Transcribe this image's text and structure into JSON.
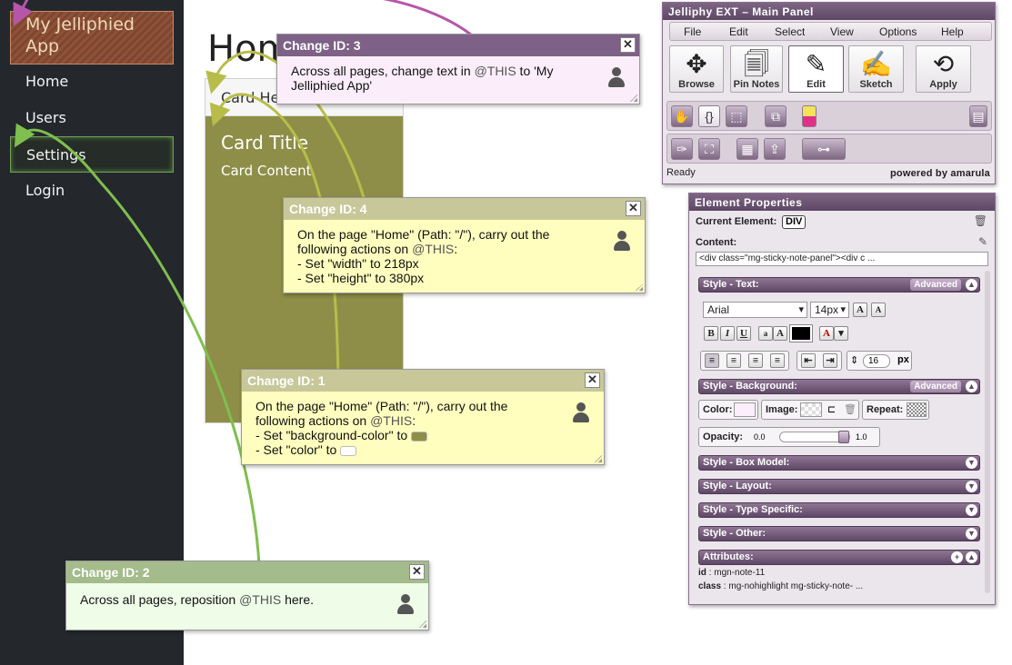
{
  "app": {
    "title": "My Jelliphied App",
    "nav": [
      {
        "label": "Home"
      },
      {
        "label": "Users"
      },
      {
        "label": "Settings"
      },
      {
        "label": "Login"
      }
    ]
  },
  "page": {
    "heading": "Home",
    "card": {
      "header": "Card Header",
      "title": "Card Title",
      "content": "Card Content."
    }
  },
  "notes": [
    {
      "title": "Change ID:  3",
      "pre": "Across all pages, change text in ",
      "this": "@THIS",
      "post": " to 'My Jelliphied App'",
      "header_color": "#7e6186",
      "body_color": "#fbeefa"
    },
    {
      "title": "Change ID:  4",
      "line1_pre": "On the page \"Home\" (Path: \"/\"), carry out the following actions on ",
      "this": "@THIS",
      "line1_post": ":",
      "bullets": [
        "- Set \"width\" to 218px",
        "- Set \"height\" to 380px"
      ],
      "header_color": "#c7c79a",
      "body_color": "#fffebf"
    },
    {
      "title": "Change ID:  1",
      "line1_pre": "On the page \"Home\" (Path: \"/\"), carry out the following actions on ",
      "this": "@THIS",
      "line1_post": ":",
      "bullets": [
        "- Set \"background-color\" to",
        "- Set \"color\" to"
      ],
      "swatches": [
        "#8e8e48",
        "#ffffff"
      ],
      "header_color": "#c7c79a",
      "body_color": "#fffebf"
    },
    {
      "title": "Change ID:  2",
      "pre": "Across all pages, reposition ",
      "this": "@THIS",
      "post": " here.",
      "header_color": "#a4bb8c",
      "body_color": "#eefce8"
    }
  ],
  "main_panel": {
    "title": "Jelliphy EXT –  Main Panel",
    "menu": [
      "File",
      "Edit",
      "Select",
      "View",
      "Options",
      "Help"
    ],
    "tools": [
      {
        "label": "Browse",
        "icon": "browse-icon"
      },
      {
        "label": "Pin Notes",
        "icon": "pin-notes-icon"
      },
      {
        "label": "Edit",
        "icon": "edit-icon"
      },
      {
        "label": "Sketch",
        "icon": "sketch-icon"
      },
      {
        "label": "Apply",
        "icon": "apply-icon"
      }
    ],
    "status": "Ready",
    "powered": "powered by amarula"
  },
  "props": {
    "title": "Element Properties",
    "current_label": "Current Element:",
    "current_value": "DIV",
    "content_label": "Content:",
    "content_value": "<div class=\"mg-sticky-note-panel\"><div c ...",
    "sections": {
      "text": "Style - Text:",
      "background": "Style - Background:",
      "box": "Style - Box Model:",
      "layout": "Style - Layout:",
      "type": "Style - Type Specific:",
      "other": "Style - Other:",
      "attributes": "Attributes:"
    },
    "advanced": "Advanced",
    "font_family": "Arial",
    "font_size": "14px",
    "line_height": "16",
    "line_height_unit": "px",
    "color_label": "Color:",
    "image_label": "Image:",
    "repeat_label": "Repeat:",
    "opacity_label": "Opacity:",
    "opacity_min": "0.0",
    "opacity_max": "1.0",
    "opacity_value": 1.0,
    "attributes": [
      {
        "key": "id",
        "value": "mgn-note-11"
      },
      {
        "key": "class",
        "value": "mg-nohighlight mg-sticky-note- ..."
      }
    ]
  }
}
